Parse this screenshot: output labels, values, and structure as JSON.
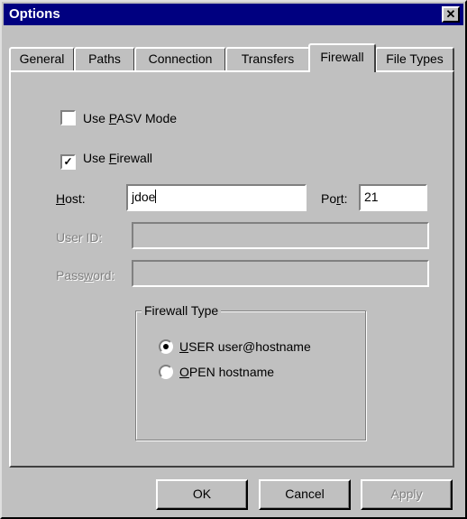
{
  "window": {
    "title": "Options",
    "close_glyph": "✕"
  },
  "tabs": [
    {
      "label": "General"
    },
    {
      "label": "Paths"
    },
    {
      "label": "Connection"
    },
    {
      "label": "Transfers"
    },
    {
      "label": "Firewall",
      "active": true
    },
    {
      "label": "File Types"
    }
  ],
  "firewall": {
    "use_pasv": {
      "prefix": "Use ",
      "mnemonic": "P",
      "rest": "ASV Mode",
      "checked": false
    },
    "use_firewall": {
      "prefix": "Use ",
      "mnemonic": "F",
      "rest": "irewall",
      "checked": true,
      "check_glyph": "✓"
    },
    "host": {
      "mnemonic": "H",
      "rest": "ost:",
      "value": "jdoe"
    },
    "port": {
      "prefix": "Po",
      "mnemonic": "r",
      "rest": "t:",
      "value": "21"
    },
    "user_id": {
      "label": "User ID:",
      "value": "",
      "enabled": false
    },
    "password": {
      "prefix": "Pass",
      "mnemonic": "w",
      "rest": "ord:",
      "value": "",
      "enabled": false
    },
    "firewall_type": {
      "title": "Firewall Type",
      "options": [
        {
          "mnemonic": "U",
          "rest": "SER user@hostname",
          "selected": true
        },
        {
          "mnemonic": "O",
          "rest": "PEN hostname",
          "selected": false
        }
      ]
    }
  },
  "buttons": {
    "ok": "OK",
    "cancel": "Cancel",
    "apply": "Apply",
    "apply_enabled": false
  }
}
